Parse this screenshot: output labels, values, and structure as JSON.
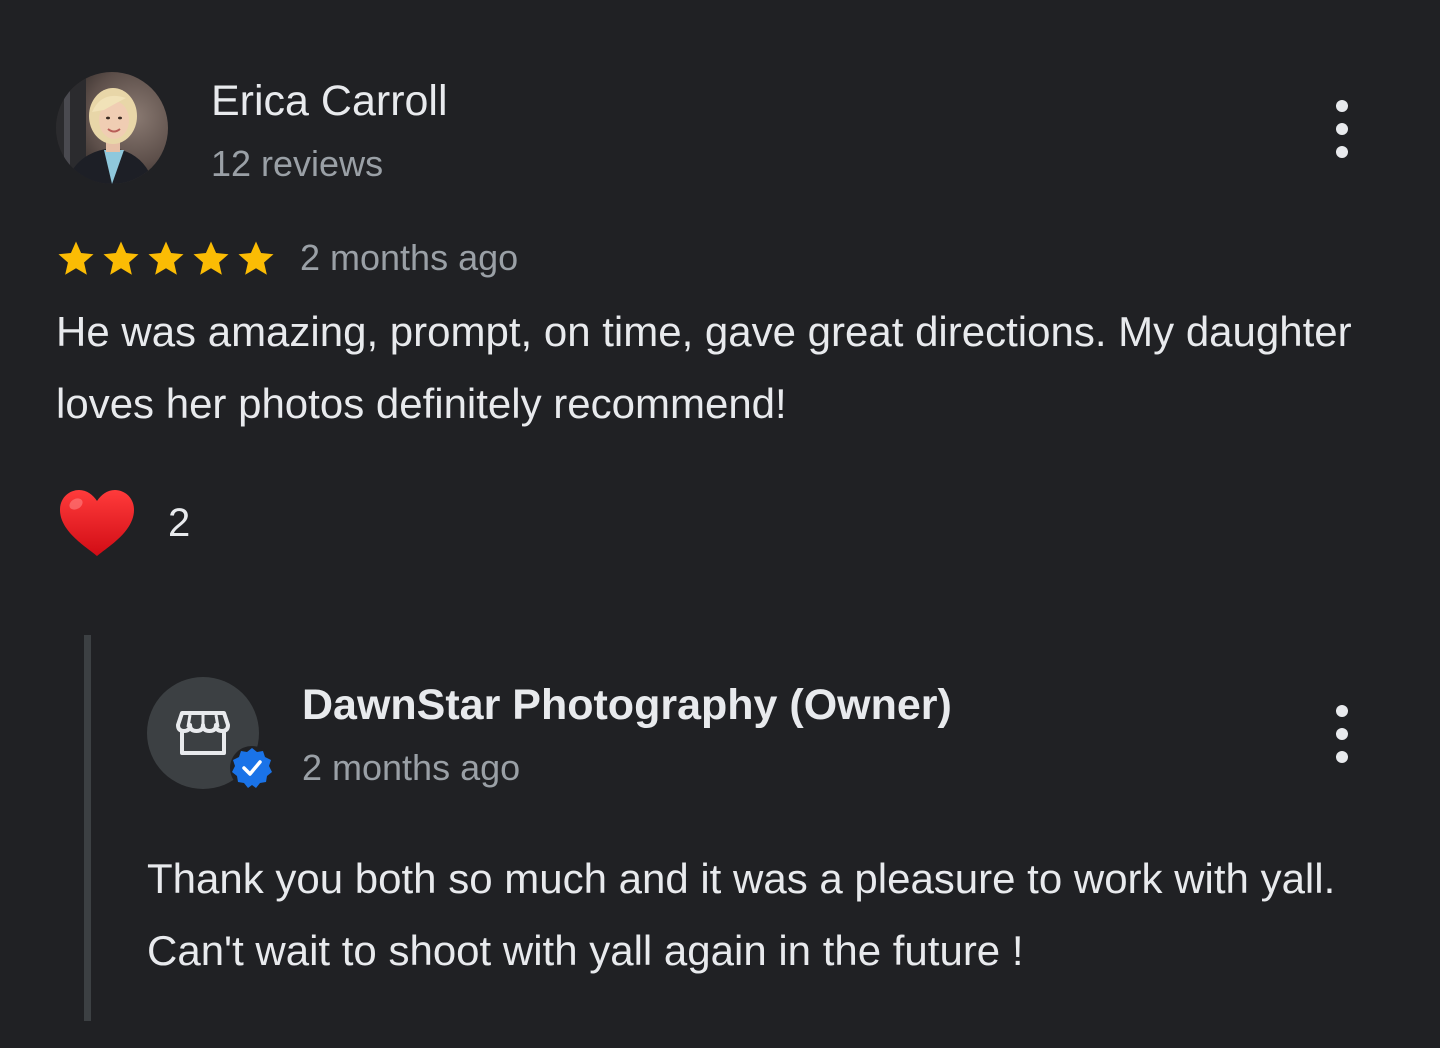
{
  "review": {
    "reviewer_name": "Erica Carroll",
    "reviewer_meta": "12 reviews",
    "rating": 5,
    "rating_max": 5,
    "date": "2 months ago",
    "text": "He was amazing, prompt, on time, gave great directions. My daughter loves her photos definitely recommend!",
    "reaction": {
      "icon": "heart-icon",
      "count": "2"
    }
  },
  "owner_reply": {
    "name": "DawnStar Photography (Owner)",
    "date": "2 months ago",
    "text": "Thank you both so much and it was a pleasure to work with yall. Can't wait to shoot with yall again in the future !",
    "avatar_icon": "storefront-icon",
    "badge_icon": "verified-badge-icon"
  },
  "colors": {
    "background": "#202124",
    "text_primary": "#e8eaed",
    "text_secondary": "#9aa0a6",
    "star": "#fbbc04",
    "heart": "#e2161b",
    "verified": "#1a73e8",
    "reply_bar": "#3c4043"
  },
  "icons": {
    "more_options": "more-vert-icon"
  }
}
